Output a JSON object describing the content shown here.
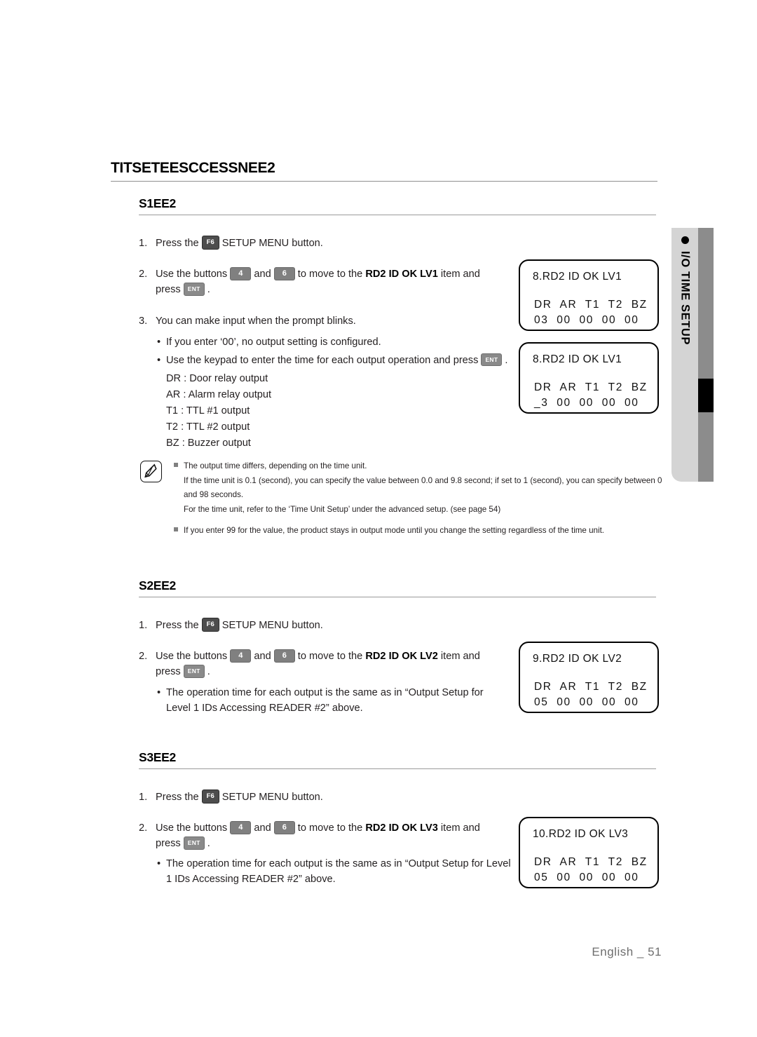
{
  "page": {
    "main_title": "TITSETEESCCESSNEE2",
    "footer": "English _  51"
  },
  "side_tab": {
    "label": "I/O TIME SETUP",
    "dot_icon": "bullet-dot-icon",
    "panel_color": "#d4d4d4",
    "bar_color": "#8c8c8c",
    "marker_color": "#000000"
  },
  "keys": {
    "f6": "F6",
    "four": "4",
    "six": "6",
    "ent": "ENT"
  },
  "sections": [
    {
      "heading": "S1EE2",
      "steps": [
        {
          "num": "1.",
          "pre": "Press the ",
          "key": "F6",
          "post": " SETUP MENU button."
        },
        {
          "num": "2.",
          "pre": "Use the buttons ",
          "k1": "4",
          "mid1": " and ",
          "k2": "6",
          "mid2": " to move to the ",
          "bold": "RD2 ID OK LV1",
          "mid3": " item and press ",
          "k3": "ENT",
          "post": " ."
        },
        {
          "num": "3.",
          "text": "You can make input when the prompt blinks."
        }
      ],
      "bullets": [
        "If you enter ‘00’, no output setting is configured.",
        "Use the keypad to enter the time for each output operation and press"
      ],
      "definitions": [
        "DR : Door relay output",
        "AR : Alarm relay output",
        "T1 : TTL #1 output",
        "T2 : TTL #2 output",
        "BZ : Buzzer output"
      ]
    },
    {
      "heading": "S2EE2",
      "steps": [
        {
          "num": "1.",
          "pre": "Press the ",
          "key": "F6",
          "post": " SETUP MENU button."
        },
        {
          "num": "2.",
          "pre": "Use the buttons ",
          "k1": "4",
          "mid1": " and ",
          "k2": "6",
          "mid2": " to move to the ",
          "bold": "RD2 ID OK LV2",
          "mid3": " item and press ",
          "k3": "ENT",
          "post": " ."
        }
      ],
      "bullet_line1": "The operation time for each output is the same as in “Output Setup for",
      "bullet_line2": "Level 1 IDs Accessing READER #2” above."
    },
    {
      "heading": "S3EE2",
      "steps": [
        {
          "num": "1.",
          "pre": "Press the ",
          "key": "F6",
          "post": " SETUP MENU button."
        },
        {
          "num": "2.",
          "pre": "Use the buttons ",
          "k1": "4",
          "mid1": " and ",
          "k2": "6",
          "mid2": " to move to the ",
          "bold": "RD2 ID OK LV3",
          "mid3": " item and press ",
          "k3": "ENT",
          "post": " ."
        }
      ],
      "bullet_line1": "The operation time for each output is the same as in “Output Setup for Level",
      "bullet_line2": "1 IDs Accessing READER #2” above."
    }
  ],
  "note": {
    "icon": "note-pen-icon",
    "items": [
      {
        "lines": [
          "The output time differs, depending on the time unit.",
          "If the time unit is 0.1 (second), you can specify the value between 0.0 and 9.8 second; if set to 1 (second), you can specify between 0 and 98 seconds.",
          "For the time unit, refer to the ‘Time Unit Setup’ under the advanced setup. (see page 54)"
        ]
      },
      {
        "lines": [
          "If you enter 99 for the value, the product stays in output mode until you change the setting regardless of the time unit."
        ]
      }
    ]
  },
  "lcd_screens": [
    {
      "title": "8.RD2 ID OK LV1",
      "header": "DR  AR  T1  T2  BZ",
      "values": "03  00  00  00  00"
    },
    {
      "title": "8.RD2 ID OK LV1",
      "header": "DR  AR  T1  T2  BZ",
      "values": "_3  00  00  00  00"
    },
    {
      "title": "9.RD2 ID OK LV2",
      "header": "DR  AR  T1  T2  BZ",
      "values": "05  00  00  00  00"
    },
    {
      "title": "10.RD2 ID OK LV3",
      "header": "DR  AR  T1  T2  BZ",
      "values": "05  00  00  00  00"
    }
  ]
}
